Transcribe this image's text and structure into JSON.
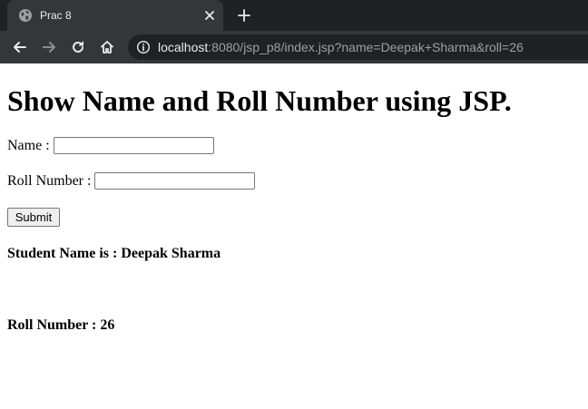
{
  "browser": {
    "tab_title": "Prac 8",
    "url_host": "localhost",
    "url_rest": ":8080/jsp_p8/index.jsp?name=Deepak+Sharma&roll=26",
    "icons": {
      "favicon": "globe-icon",
      "close": "close-icon",
      "new_tab": "plus-icon",
      "back": "back-arrow-icon",
      "forward": "forward-arrow-icon",
      "reload": "reload-icon",
      "home": "home-icon",
      "site_info": "info-icon"
    },
    "colors": {
      "tabstrip": "#202124",
      "toolbar": "#35363a",
      "text": "#e8eaed"
    }
  },
  "page": {
    "heading": "Show Name and Roll Number using JSP.",
    "form": {
      "name_label": "Name :",
      "name_value": "",
      "roll_label": "Roll Number :",
      "roll_value": "",
      "submit_label": "Submit"
    },
    "results": {
      "student_name": "Student Name is : Deepak Sharma",
      "roll_number": "Roll Number : 26"
    }
  }
}
